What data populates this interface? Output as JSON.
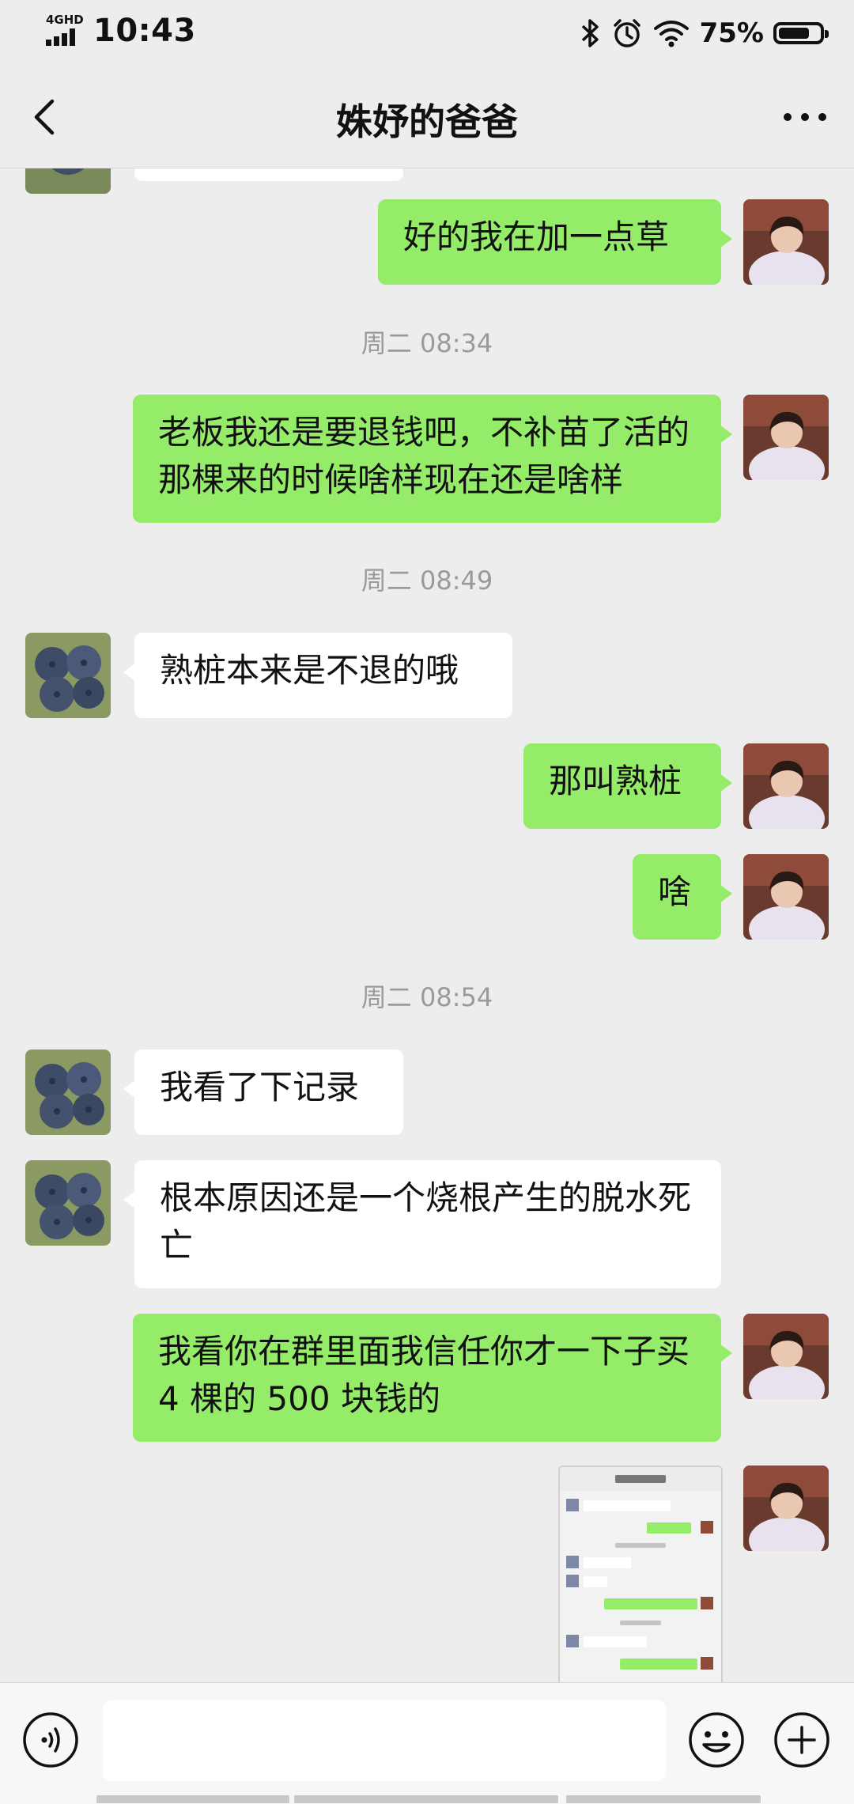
{
  "status_bar": {
    "network": "4GHD",
    "time": "10:43",
    "battery_percent": "75%",
    "battery_level": 0.75,
    "icons": [
      "bluetooth-icon",
      "alarm-icon",
      "wifi-icon",
      "battery-icon"
    ]
  },
  "header": {
    "title": "姝妤的爸爸",
    "back_icon": "chevron-left-icon",
    "more_icon": "more-dots-icon"
  },
  "messages": {
    "m1": "好的我在加一点草",
    "ts1": "周二 08:34",
    "m2": "老板我还是要退钱吧，不补苗了活的那棵来的时候啥样现在还是啥样",
    "ts2": "周二 08:49",
    "m3": "熟桩本来是不退的哦",
    "m4": "那叫熟桩",
    "m5": "啥",
    "ts3": "周二 08:54",
    "m6": "我看了下记录",
    "m7": "根本原因还是一个烧根产生的脱水死亡",
    "m8": "我看你在群里面我信任你才一下子买 4 棵的 500 块钱的",
    "m9_type": "image"
  },
  "input_bar": {
    "voice_icon": "voice-icon",
    "emoji_icon": "emoji-icon",
    "plus_icon": "plus-icon",
    "placeholder": ""
  },
  "colors": {
    "background": "#ededed",
    "outgoing_bubble": "#95ec69",
    "incoming_bubble": "#ffffff",
    "timestamp_text": "#9a9a9a"
  }
}
